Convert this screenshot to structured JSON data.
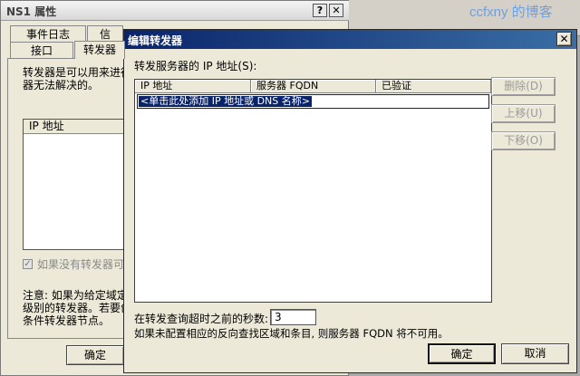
{
  "bg_dialog": {
    "title": "NS1 属性",
    "help_glyph": "?",
    "close_glyph": "✕",
    "tabs_row1": [
      "事件日志",
      "信"
    ],
    "tabs_row2": [
      "接口",
      "转发器"
    ],
    "desc_line1": "转发器是可以用来进行",
    "desc_line2": "器无法解决的。",
    "list_header": "IP 地址",
    "checkbox_label": "如果没有转发器可用",
    "note_line1": "注意: 如果为给定域定",
    "note_line2": "级别的转发器。若要创",
    "note_line3": "条件转发器节点。",
    "ok_label": "确定"
  },
  "watermark": "ccfxny 的博客",
  "dialog": {
    "title": "编辑转发器",
    "close_glyph": "✕",
    "servers_label": "转发服务器的 IP 地址(S):",
    "columns": [
      "IP 地址",
      "服务器 FQDN",
      "已验证"
    ],
    "edit_placeholder": "<单击此处添加 IP 地址或 DNS 名称>",
    "remove_label": "删除(D)",
    "up_label": "上移(U)",
    "down_label": "下移(O)",
    "timeout_label": "在转发查询超时之前的秒数:",
    "timeout_value": "3",
    "info_text": "如果未配置相应的反向查找区域和条目, 则服务器 FQDN 将不可用。",
    "ok_label": "确定",
    "cancel_label": "取消"
  }
}
